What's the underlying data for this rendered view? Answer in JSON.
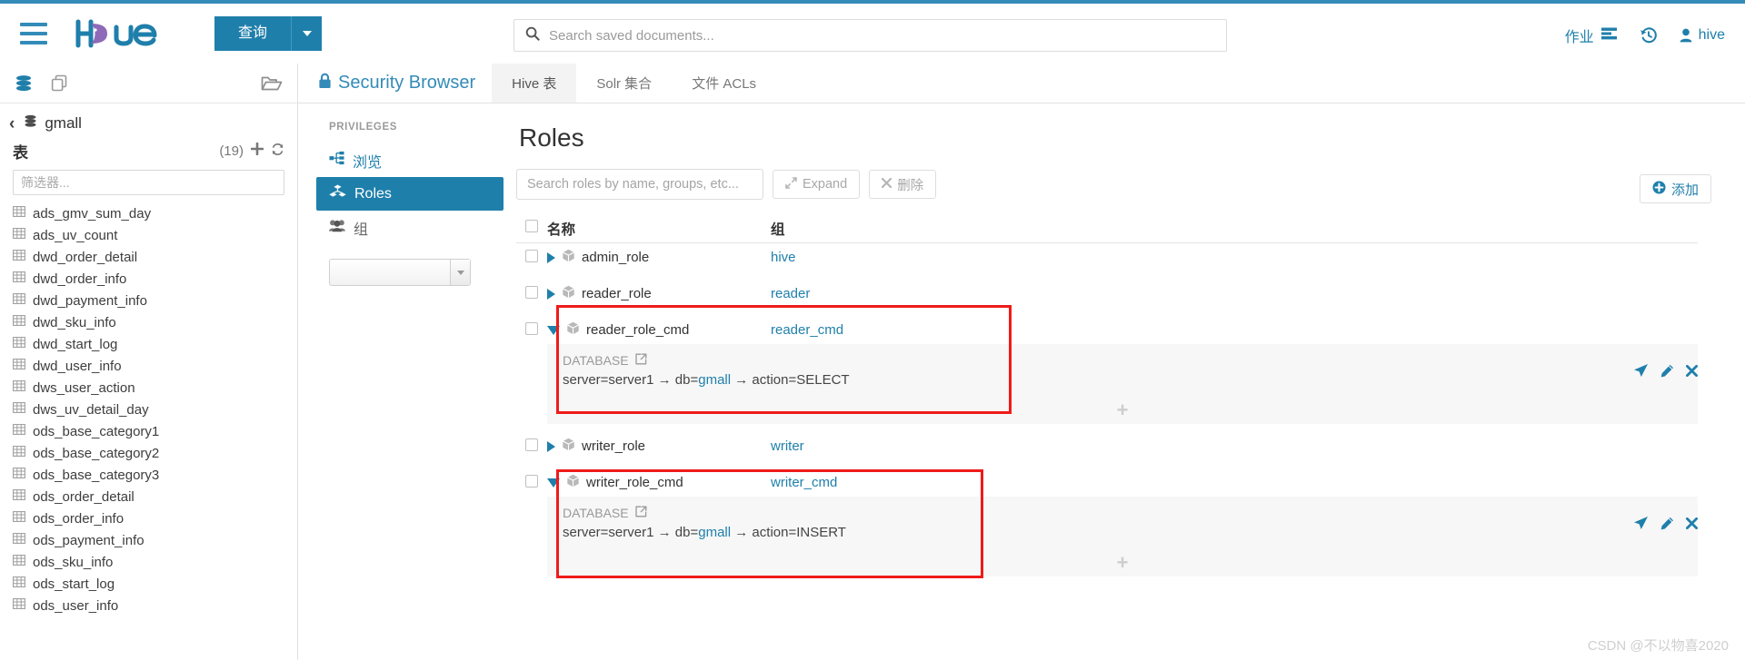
{
  "header": {
    "menu_icon": "hamburger-icon",
    "logo_text": "hue",
    "query_button": "查询",
    "search_placeholder": "Search saved documents...",
    "jobs_label": "作业",
    "history_icon": "history-icon",
    "user_label": "hive",
    "accent_color": "#1f7fab",
    "top_border_color": "#338bb8"
  },
  "assist": {
    "db_icon": "database-icon",
    "docs_icon": "documents-icon",
    "folder_icon": "folder-open-icon",
    "database_name": "gmall",
    "tables_label": "表",
    "tables_count": "(19)",
    "add_icon": "plus-icon",
    "refresh_icon": "refresh-icon",
    "filter_placeholder": "筛选器...",
    "tables": [
      "ads_gmv_sum_day",
      "ads_uv_count",
      "dwd_order_detail",
      "dwd_order_info",
      "dwd_payment_info",
      "dwd_sku_info",
      "dwd_start_log",
      "dwd_user_info",
      "dws_user_action",
      "dws_uv_detail_day",
      "ods_base_category1",
      "ods_base_category2",
      "ods_base_category3",
      "ods_order_detail",
      "ods_order_info",
      "ods_payment_info",
      "ods_sku_info",
      "ods_start_log",
      "ods_user_info"
    ]
  },
  "security": {
    "title": "Security Browser",
    "lock_icon": "lock-icon",
    "tabs": [
      {
        "label": "Hive 表",
        "active": true
      },
      {
        "label": "Solr 集合",
        "active": false
      },
      {
        "label": "文件 ACLs",
        "active": false
      }
    ]
  },
  "privileges": {
    "caption": "PRIVILEGES",
    "items": [
      {
        "label": "浏览",
        "icon": "sitemap-icon",
        "active": false
      },
      {
        "label": "Roles",
        "icon": "roles-cubes-icon",
        "active": true
      },
      {
        "label": "组",
        "icon": "group-icon",
        "active": false
      }
    ],
    "select_value": ""
  },
  "roles_page": {
    "title": "Roles",
    "search_placeholder": "Search roles by name, groups, etc...",
    "expand_label": "Expand",
    "expand_icon": "expand-arrows-icon",
    "delete_label": "删除",
    "delete_icon": "x-icon",
    "add_label": "添加",
    "add_icon": "plus-circle-icon",
    "columns": {
      "name": "名称",
      "group": "组"
    },
    "add_row_glyph": "+",
    "rows": [
      {
        "name": "admin_role",
        "group": "hive",
        "expanded": false,
        "highlighted": false,
        "privileges": []
      },
      {
        "name": "reader_role",
        "group": "reader",
        "expanded": false,
        "highlighted": false,
        "privileges": []
      },
      {
        "name": "reader_role_cmd",
        "group": "reader_cmd",
        "expanded": true,
        "highlighted": true,
        "privileges": [
          {
            "scope": "DATABASE",
            "link_icon": "external-link-icon",
            "path": "server=server1 → db=gmall → action=SELECT",
            "path_prefix": "server=server1 → db=",
            "path_link": "gmall",
            "path_suffix": " → action=SELECT",
            "actions": [
              "share-icon",
              "edit-pencil-icon",
              "delete-x-icon"
            ]
          }
        ]
      },
      {
        "name": "writer_role",
        "group": "writer",
        "expanded": false,
        "highlighted": false,
        "privileges": []
      },
      {
        "name": "writer_role_cmd",
        "group": "writer_cmd",
        "expanded": true,
        "highlighted": true,
        "privileges": [
          {
            "scope": "DATABASE",
            "link_icon": "external-link-icon",
            "path": "server=server1 → db=gmall → action=INSERT",
            "path_prefix": "server=server1 → db=",
            "path_link": "gmall",
            "path_suffix": " → action=INSERT",
            "actions": [
              "share-icon",
              "edit-pencil-icon",
              "delete-x-icon"
            ]
          }
        ]
      }
    ]
  },
  "watermark": "CSDN @不以物喜2020"
}
